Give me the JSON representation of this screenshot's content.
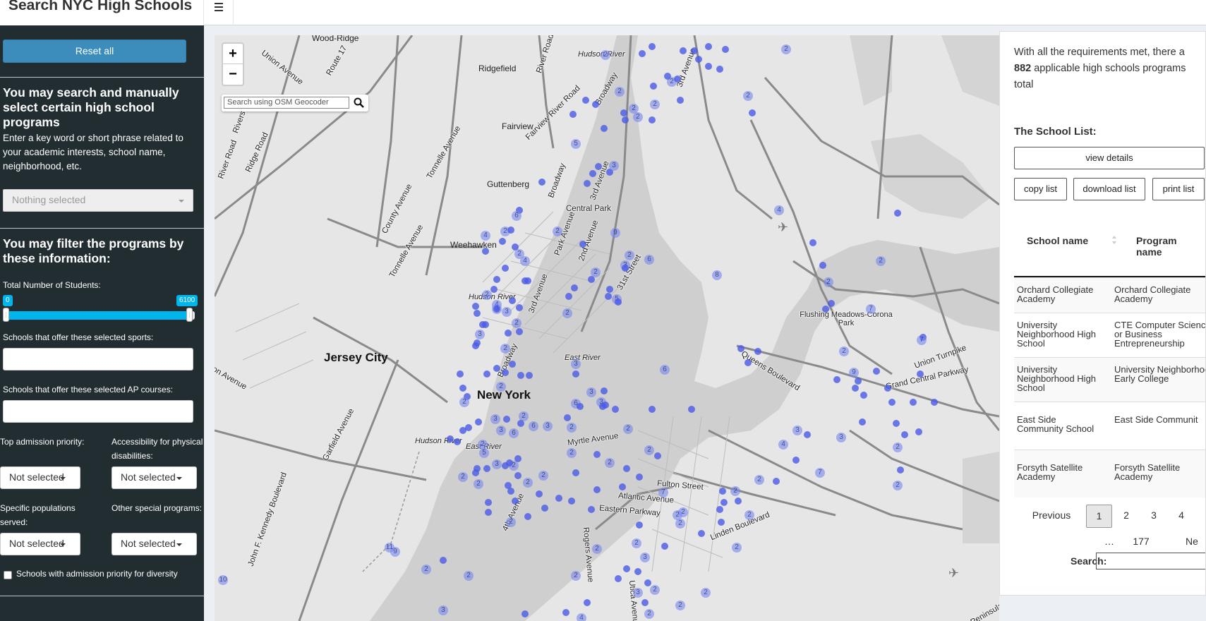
{
  "header": {
    "title": "Search NYC High Schools"
  },
  "sidebar": {
    "reset_label": "Reset all",
    "search_heading": "You may search and manually select certain high school programs",
    "search_help": "Enter a key word or short phrase related to your academic interests, school name, neighborhood, etc.",
    "search_select_placeholder": "Nothing selected",
    "filter_heading": "You may filter the programs by these information:",
    "students_label": "Total Number of Students:",
    "students_min": "0",
    "students_max": "6100",
    "sports_label": "Schools that offer these selected sports:",
    "ap_label": "Schools that offer these selected AP courses:",
    "admission_label": "Top admission priority:",
    "admission_value": "Not selected",
    "accessibility_label": "Accessibility for physical disabilities:",
    "accessibility_value": "Not selected",
    "populations_label": "Specific populations served:",
    "populations_value": "Not selected",
    "special_label": "Other special programs:",
    "special_value": "Not selected",
    "diversity_label": "Schools with admission priority for diversity"
  },
  "map": {
    "zoom_in": "+",
    "zoom_out": "−",
    "geocoder_placeholder": "Search using OSM Geocoder",
    "labels": {
      "wood_ridge": "Wood-Ridge",
      "ridgefield": "Ridgefield",
      "fairview": "Fairview",
      "guttenberg": "Guttenberg",
      "weehawken": "Weehawken",
      "jersey_city": "Jersey City",
      "new_york": "New York",
      "central_park": "Central Park",
      "flushing": "Flushing Meadows-Corona Park",
      "hudson_river_1": "Hudson River",
      "hudson_river_2": "Hudson River",
      "hudson_river_3": "Hudson River",
      "east_river_1": "East River",
      "east_river_2": "East River",
      "union_avenue": "Union Avenue",
      "route_17": "Route 17",
      "river_road": "River Road",
      "fairview_river_road": "Fairview River Road",
      "tonnelle_1": "Tonnelle Avenue",
      "tonnelle_2": "Tonnelle Avenue",
      "county_avenue": "County Avenue",
      "ridge_road": "Ridge Road",
      "river_road_2": "River Road",
      "riverside": "Riverside",
      "broadway_1": "Broadway",
      "broadway_2": "Broadway",
      "broadway_3": "Broadway",
      "third_avenue_1": "3rd Avenue",
      "third_avenue_2": "3rd Avenue",
      "park_avenue": "Park Avenue",
      "second_avenue": "2nd Avenue",
      "third_avenue_3": "3rd Avenue",
      "street_31": "31st Street",
      "queens_blvd": "Queens Boulevard",
      "union_turnpike": "Union Turnpike",
      "grand_central": "Grand Central Parkway",
      "myrtle": "Myrtle Avenue",
      "fulton": "Fulton Street",
      "atlantic": "Atlantic Avenue",
      "eastern_pkwy": "Eastern Parkway",
      "linden": "Linden Boulevard",
      "fourth_ave": "4th Avenue",
      "rogers": "Rogers Avenue",
      "utica": "Utica Avenue",
      "garfield": "Garfield Avenue",
      "jfk_blvd": "John F. Kennedy Boulevard",
      "on_avenue": "on Avenue",
      "peninsula": "Peninsula Bo",
      "broadway_4": "Broadway"
    },
    "marker_color": "#4a5ae6"
  },
  "panel": {
    "summary_prefix": "With all the requirements met, there a",
    "summary_count": "882",
    "summary_suffix": " applicable high schools programs",
    "summary_tail": "total",
    "list_title": "The School List:",
    "view_details": "view details",
    "copy_list": "copy list",
    "download_list": "download list",
    "print_list": "print list",
    "columns": [
      "School name",
      "Program name"
    ],
    "rows": [
      [
        "Orchard Collegiate Academy",
        "Orchard Collegiate Academy"
      ],
      [
        "University Neighborhood High School",
        "CTE Computer Science or Business Entrepreneurship"
      ],
      [
        "University Neighborhood High School",
        "University Neighborhood Early College"
      ],
      [
        "East Side Community School",
        "East Side Communit"
      ],
      [
        "Forsyth Satellite Academy",
        "Forsyth Satellite Academy"
      ]
    ],
    "pagination": {
      "previous": "Previous",
      "pages": [
        "1",
        "2",
        "3",
        "4"
      ],
      "ellipsis": "…",
      "last": "177",
      "next": "Ne"
    },
    "search_label": "Search:"
  }
}
